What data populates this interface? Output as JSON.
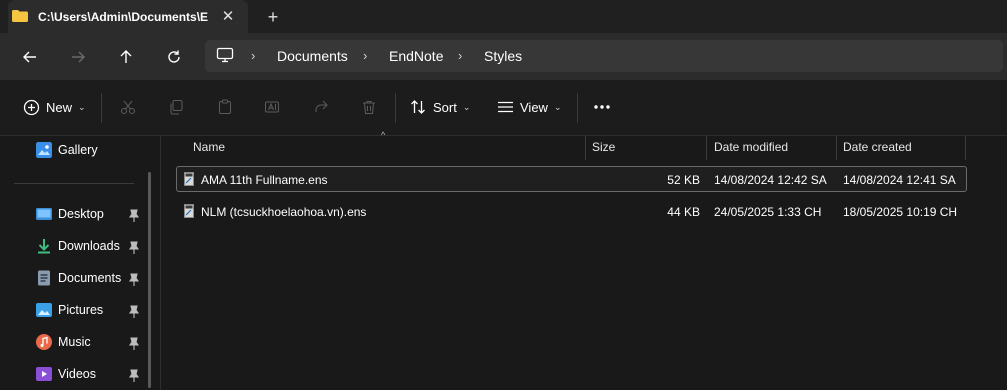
{
  "tab": {
    "title": "C:\\Users\\Admin\\Documents\\E",
    "close": "✕",
    "add": "+"
  },
  "breadcrumb": [
    "Documents",
    "EndNote",
    "Styles"
  ],
  "commands": {
    "new": "New",
    "sort": "Sort",
    "view": "View"
  },
  "sidebar": {
    "top_item": "Gallery",
    "items": [
      {
        "label": "Desktop",
        "icon": "desktop-icon",
        "color": "#3b8fd9"
      },
      {
        "label": "Downloads",
        "icon": "download-icon",
        "color": "#3cbf7f"
      },
      {
        "label": "Documents",
        "icon": "document-icon",
        "color": "#8a9bb0"
      },
      {
        "label": "Pictures",
        "icon": "pictures-icon",
        "color": "#3aa0e8"
      },
      {
        "label": "Music",
        "icon": "music-icon",
        "color": "#e86a4a"
      },
      {
        "label": "Videos",
        "icon": "videos-icon",
        "color": "#8a4fd6"
      }
    ]
  },
  "columns": {
    "name": "Name",
    "size": "Size",
    "modified": "Date modified",
    "created": "Date created"
  },
  "files": [
    {
      "name": "AMA 11th Fullname.ens",
      "size": "52 KB",
      "modified": "14/08/2024 12:42 SA",
      "created": "14/08/2024 12:41 SA"
    },
    {
      "name": "NLM (tcsuckhoelaohoa.vn).ens",
      "size": "44 KB",
      "modified": "24/05/2025 1:33 CH",
      "created": "18/05/2025 10:19 CH"
    }
  ],
  "colors": {
    "accent": "#60cdff",
    "folder": "#f5c542"
  }
}
